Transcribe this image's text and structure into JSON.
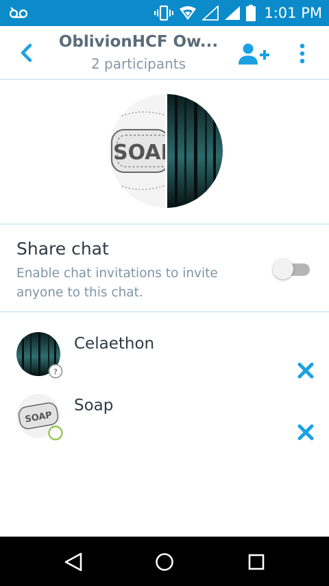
{
  "status_bar": {
    "time": "1:01 PM",
    "icons": [
      "voicemail-icon",
      "vibrate-icon",
      "wifi-icon",
      "signal-empty-icon",
      "signal-full-icon",
      "battery-icon"
    ]
  },
  "header": {
    "title": "OblivionHCF Ow...",
    "subtitle": "2 participants",
    "icons": [
      "back-arrow-icon",
      "add-person-icon",
      "more-vert-icon"
    ]
  },
  "share_chat": {
    "title": "Share chat",
    "description": "Enable chat invitations to invite anyone to this chat.",
    "enabled": false
  },
  "participants": [
    {
      "name": "Celaethon",
      "presence": "unknown"
    },
    {
      "name": "Soap",
      "presence": "online"
    }
  ],
  "nav_bar": {
    "icons": [
      "back-triangle-icon",
      "home-circle-icon",
      "recents-square-icon"
    ]
  },
  "colors": {
    "status_bar": "#0b8bc9",
    "accent": "#1ba1e2",
    "divider": "#b6dcee",
    "presence_online": "#8cc13f"
  }
}
